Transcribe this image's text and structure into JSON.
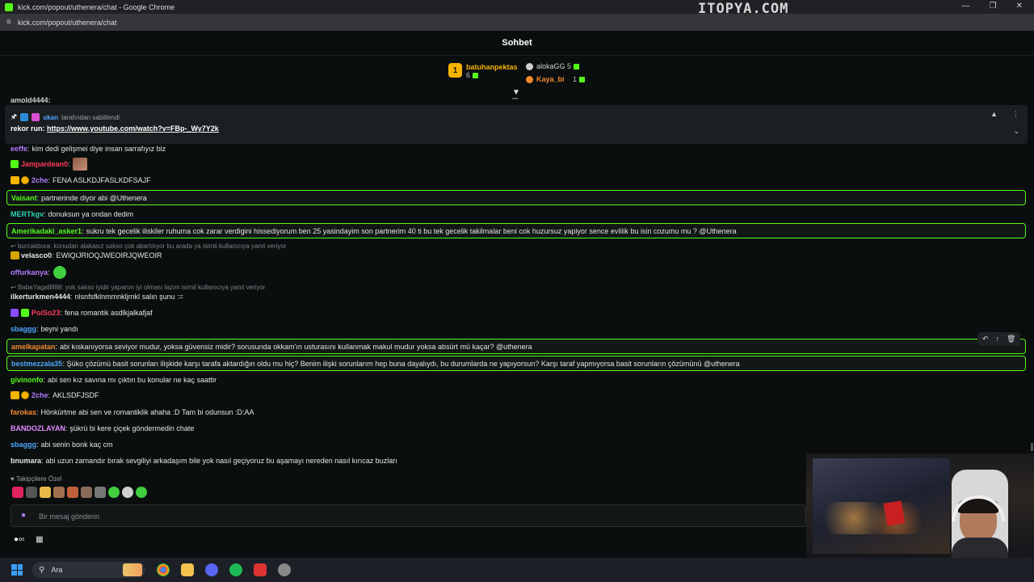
{
  "window": {
    "title": "kick.com/popout/uthenera/chat - Google Chrome",
    "url": "kick.com/popout/uthenera/chat",
    "watermark": "ITOPYA.COM"
  },
  "chat": {
    "title": "Sohbet",
    "leaderboard": [
      {
        "rank": "1",
        "name": "batuhanpektas",
        "count": "6",
        "color": "#f5b400"
      },
      {
        "name": "alokaGG",
        "count": "5",
        "color": "#cfcfcf"
      },
      {
        "name": "Kaya_bi",
        "count": "1",
        "color": "#f28a2e"
      }
    ],
    "cutoff_user": "amold4444:",
    "pinned": {
      "author": "okan",
      "pinned_by_text": "tarafından sabitlendi",
      "message_prefix": "rekor run:",
      "link": "https://www.youtube.com/watch?v=FBp-_Wy7Y2k"
    },
    "messages": [
      {
        "user": "eeffe",
        "color": "#b37cff",
        "text": "kim dedi gelişmei diye insan sarrafıyız biz"
      },
      {
        "user": "Jampardean0",
        "color": "#ff3b5c",
        "text": ""
      },
      {
        "user": "2che",
        "color": "#b37cff",
        "text": "FENA ASLKDJFASLKDFSAJF"
      },
      {
        "user": "Vaisant",
        "color": "#53fc18",
        "text": "partnerinde diyor abi @Uthenera"
      },
      {
        "user": "MERTkgv",
        "color": "#2fd3b2",
        "text": "donuksun ya ondan dedim"
      },
      {
        "user": "Amerikadaki_asker1",
        "color": "#53fc18",
        "text": "sukru tek gecelik iliskiler ruhuma cok zarar verdigini hissediyorum ben 25 yasindayim son partnerim 40 ti bu tek gecelik takilmalar beni cok huzursuz yapiyor sence evlilik bu isin cozumu mu ? @Uthenera"
      },
      {
        "reply": "burcakbora: konudan alakasız sakso çok abartılıyor bu arada ya isimli kullanıcıya yanıt veriyor"
      },
      {
        "user": "velasco0",
        "color": "#e6e6e6",
        "text": "EWIQIJRIOQJWEOIRJQWEOIR"
      },
      {
        "user": "offurkanya",
        "color": "#b37cff",
        "text": ""
      },
      {
        "reply": "BabaYaga8888: yok sakso iyidir yapanın iyi olması lazım isimli kullanıcıya yanıt veriyor"
      },
      {
        "user": "ilkerturkmen4444",
        "color": "#e6e6e6",
        "text": "nlsnfsfklnmmnkljrnkl salın şunu :="
      },
      {
        "user": "PoiSo23",
        "color": "#ff3b5c",
        "text": "fena romantik asdlkjalkafjaf"
      },
      {
        "user": "sbaggg",
        "color": "#4ea6ff",
        "text": "beyni yandı"
      },
      {
        "user": "amelkapatan",
        "color": "#f28a2e",
        "text": "abi kıskanıyorsa seviyor mudur, yoksa güvensiz midir? sorusunda okkam'ın usturasını kullanmak makul mudur yoksa absürt mü kaçar? @uthenera"
      },
      {
        "user": "bestmezzala35",
        "color": "#4ea6ff",
        "text": "Şüko çözümü basit sorunları ilişkide karşı tarafa aktardığın oldu mu hiç? Benim ilişki sorunlarım hep buna dayalıydı, bu durumlarda ne yapıyorsun? Karşı taraf yapmıyorsa basit sorunların çözümünü @uthenera"
      },
      {
        "user": "givinonfo",
        "color": "#53fc18",
        "text": "abi sen kız savına mı çıktın bu konular ne kaç saattir"
      },
      {
        "user": "2che",
        "color": "#b37cff",
        "text": "AKLSDFJSDF"
      },
      {
        "user": "farokas",
        "color": "#f28a2e",
        "text": "Hönkürtme abi sen ve romantiklik ahaha :D Tam bi odunsun :D:AA"
      },
      {
        "user": "BANDOZLAYAN",
        "color": "#e08cff",
        "text": "şükrü bi kere çiçek göndermedin chate"
      },
      {
        "user": "sbaggg",
        "color": "#4ea6ff",
        "text": "abi senin bonk kaç cm"
      },
      {
        "user": "bnumara",
        "color": "#e6e6e6",
        "text": "abi uzun zamandır bırak sevgiliyi arkadaşım bile yok nasıl geçiyoruz bu aşamayı nereden nasıl kırıcaz buzları"
      }
    ],
    "follower_only": "Takipçilere Özel",
    "input_placeholder": "Bir mesaj gönderin"
  },
  "taskbar": {
    "search_placeholder": "Ara"
  }
}
